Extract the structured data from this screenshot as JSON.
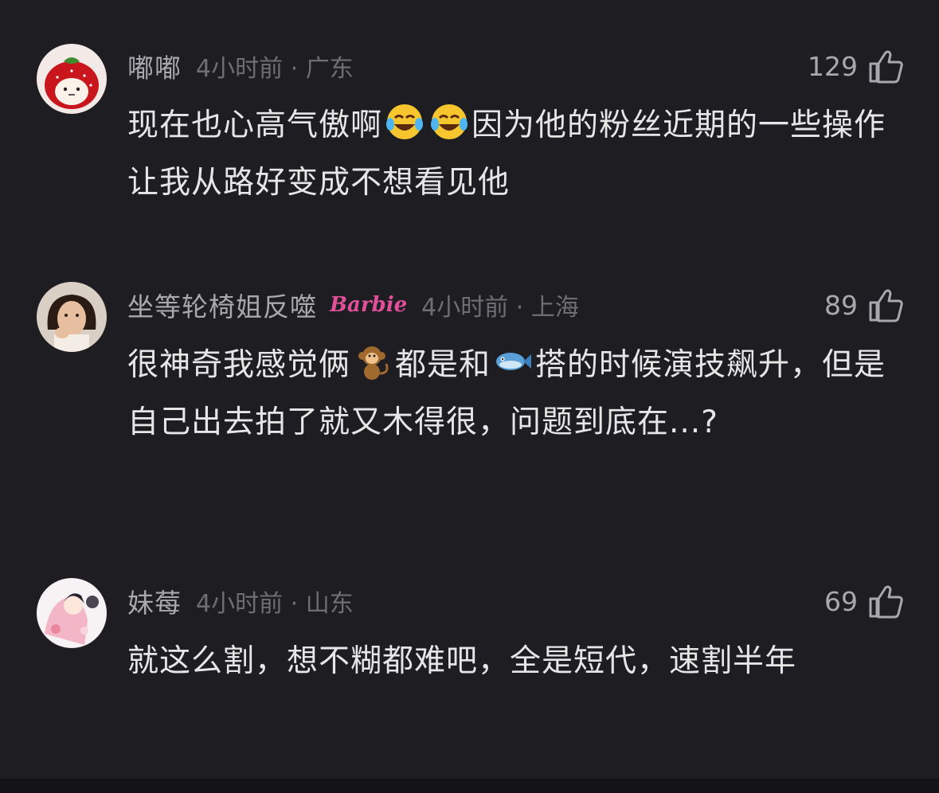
{
  "comments": [
    {
      "username": "嘟嘟",
      "badge": "",
      "time_location": "4小时前 · 广东",
      "likes": "129",
      "avatar": "strawberry-hat-avatar",
      "text_parts": [
        "现在也心高气傲啊",
        "因为他的粉丝近期的一些操作让我从路好变成不想看见他"
      ],
      "emojis": [
        "tears-of-joy-emoji",
        "tears-of-joy-emoji"
      ]
    },
    {
      "username": "坐等轮椅姐反噬",
      "badge": "Barbie",
      "time_location": "4小时前 · 上海",
      "likes": "89",
      "avatar": "woman-photo-avatar",
      "text_parts": [
        "很神奇我感觉俩",
        "都是和",
        "搭的时候演技飙升，但是自己出去拍了就又木得很，问题到底在...?"
      ],
      "emojis": [
        "monkey-emoji",
        "fish-emoji"
      ]
    },
    {
      "username": "妹莓",
      "badge": "",
      "time_location": "4小时前 · 山东",
      "likes": "69",
      "avatar": "anime-illustration-avatar",
      "text_parts": [
        "就这么割，想不糊都难吧，全是短代，速割半年"
      ],
      "emojis": []
    }
  ],
  "colors": {
    "background": "#1e1d22",
    "username": "#a9a8ad",
    "meta": "#6f6e73",
    "text": "#e6e6e6",
    "badge": "#e0509a"
  }
}
